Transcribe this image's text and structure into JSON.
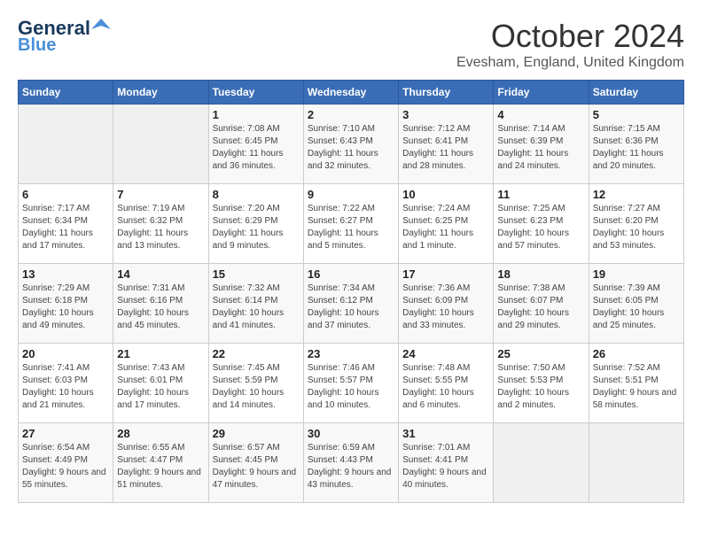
{
  "header": {
    "logo_line1": "General",
    "logo_line2": "Blue",
    "month_title": "October 2024",
    "location": "Evesham, England, United Kingdom"
  },
  "days_of_week": [
    "Sunday",
    "Monday",
    "Tuesday",
    "Wednesday",
    "Thursday",
    "Friday",
    "Saturday"
  ],
  "weeks": [
    [
      {
        "day": "",
        "info": ""
      },
      {
        "day": "",
        "info": ""
      },
      {
        "day": "1",
        "info": "Sunrise: 7:08 AM\nSunset: 6:45 PM\nDaylight: 11 hours and 36 minutes."
      },
      {
        "day": "2",
        "info": "Sunrise: 7:10 AM\nSunset: 6:43 PM\nDaylight: 11 hours and 32 minutes."
      },
      {
        "day": "3",
        "info": "Sunrise: 7:12 AM\nSunset: 6:41 PM\nDaylight: 11 hours and 28 minutes."
      },
      {
        "day": "4",
        "info": "Sunrise: 7:14 AM\nSunset: 6:39 PM\nDaylight: 11 hours and 24 minutes."
      },
      {
        "day": "5",
        "info": "Sunrise: 7:15 AM\nSunset: 6:36 PM\nDaylight: 11 hours and 20 minutes."
      }
    ],
    [
      {
        "day": "6",
        "info": "Sunrise: 7:17 AM\nSunset: 6:34 PM\nDaylight: 11 hours and 17 minutes."
      },
      {
        "day": "7",
        "info": "Sunrise: 7:19 AM\nSunset: 6:32 PM\nDaylight: 11 hours and 13 minutes."
      },
      {
        "day": "8",
        "info": "Sunrise: 7:20 AM\nSunset: 6:29 PM\nDaylight: 11 hours and 9 minutes."
      },
      {
        "day": "9",
        "info": "Sunrise: 7:22 AM\nSunset: 6:27 PM\nDaylight: 11 hours and 5 minutes."
      },
      {
        "day": "10",
        "info": "Sunrise: 7:24 AM\nSunset: 6:25 PM\nDaylight: 11 hours and 1 minute."
      },
      {
        "day": "11",
        "info": "Sunrise: 7:25 AM\nSunset: 6:23 PM\nDaylight: 10 hours and 57 minutes."
      },
      {
        "day": "12",
        "info": "Sunrise: 7:27 AM\nSunset: 6:20 PM\nDaylight: 10 hours and 53 minutes."
      }
    ],
    [
      {
        "day": "13",
        "info": "Sunrise: 7:29 AM\nSunset: 6:18 PM\nDaylight: 10 hours and 49 minutes."
      },
      {
        "day": "14",
        "info": "Sunrise: 7:31 AM\nSunset: 6:16 PM\nDaylight: 10 hours and 45 minutes."
      },
      {
        "day": "15",
        "info": "Sunrise: 7:32 AM\nSunset: 6:14 PM\nDaylight: 10 hours and 41 minutes."
      },
      {
        "day": "16",
        "info": "Sunrise: 7:34 AM\nSunset: 6:12 PM\nDaylight: 10 hours and 37 minutes."
      },
      {
        "day": "17",
        "info": "Sunrise: 7:36 AM\nSunset: 6:09 PM\nDaylight: 10 hours and 33 minutes."
      },
      {
        "day": "18",
        "info": "Sunrise: 7:38 AM\nSunset: 6:07 PM\nDaylight: 10 hours and 29 minutes."
      },
      {
        "day": "19",
        "info": "Sunrise: 7:39 AM\nSunset: 6:05 PM\nDaylight: 10 hours and 25 minutes."
      }
    ],
    [
      {
        "day": "20",
        "info": "Sunrise: 7:41 AM\nSunset: 6:03 PM\nDaylight: 10 hours and 21 minutes."
      },
      {
        "day": "21",
        "info": "Sunrise: 7:43 AM\nSunset: 6:01 PM\nDaylight: 10 hours and 17 minutes."
      },
      {
        "day": "22",
        "info": "Sunrise: 7:45 AM\nSunset: 5:59 PM\nDaylight: 10 hours and 14 minutes."
      },
      {
        "day": "23",
        "info": "Sunrise: 7:46 AM\nSunset: 5:57 PM\nDaylight: 10 hours and 10 minutes."
      },
      {
        "day": "24",
        "info": "Sunrise: 7:48 AM\nSunset: 5:55 PM\nDaylight: 10 hours and 6 minutes."
      },
      {
        "day": "25",
        "info": "Sunrise: 7:50 AM\nSunset: 5:53 PM\nDaylight: 10 hours and 2 minutes."
      },
      {
        "day": "26",
        "info": "Sunrise: 7:52 AM\nSunset: 5:51 PM\nDaylight: 9 hours and 58 minutes."
      }
    ],
    [
      {
        "day": "27",
        "info": "Sunrise: 6:54 AM\nSunset: 4:49 PM\nDaylight: 9 hours and 55 minutes."
      },
      {
        "day": "28",
        "info": "Sunrise: 6:55 AM\nSunset: 4:47 PM\nDaylight: 9 hours and 51 minutes."
      },
      {
        "day": "29",
        "info": "Sunrise: 6:57 AM\nSunset: 4:45 PM\nDaylight: 9 hours and 47 minutes."
      },
      {
        "day": "30",
        "info": "Sunrise: 6:59 AM\nSunset: 4:43 PM\nDaylight: 9 hours and 43 minutes."
      },
      {
        "day": "31",
        "info": "Sunrise: 7:01 AM\nSunset: 4:41 PM\nDaylight: 9 hours and 40 minutes."
      },
      {
        "day": "",
        "info": ""
      },
      {
        "day": "",
        "info": ""
      }
    ]
  ]
}
